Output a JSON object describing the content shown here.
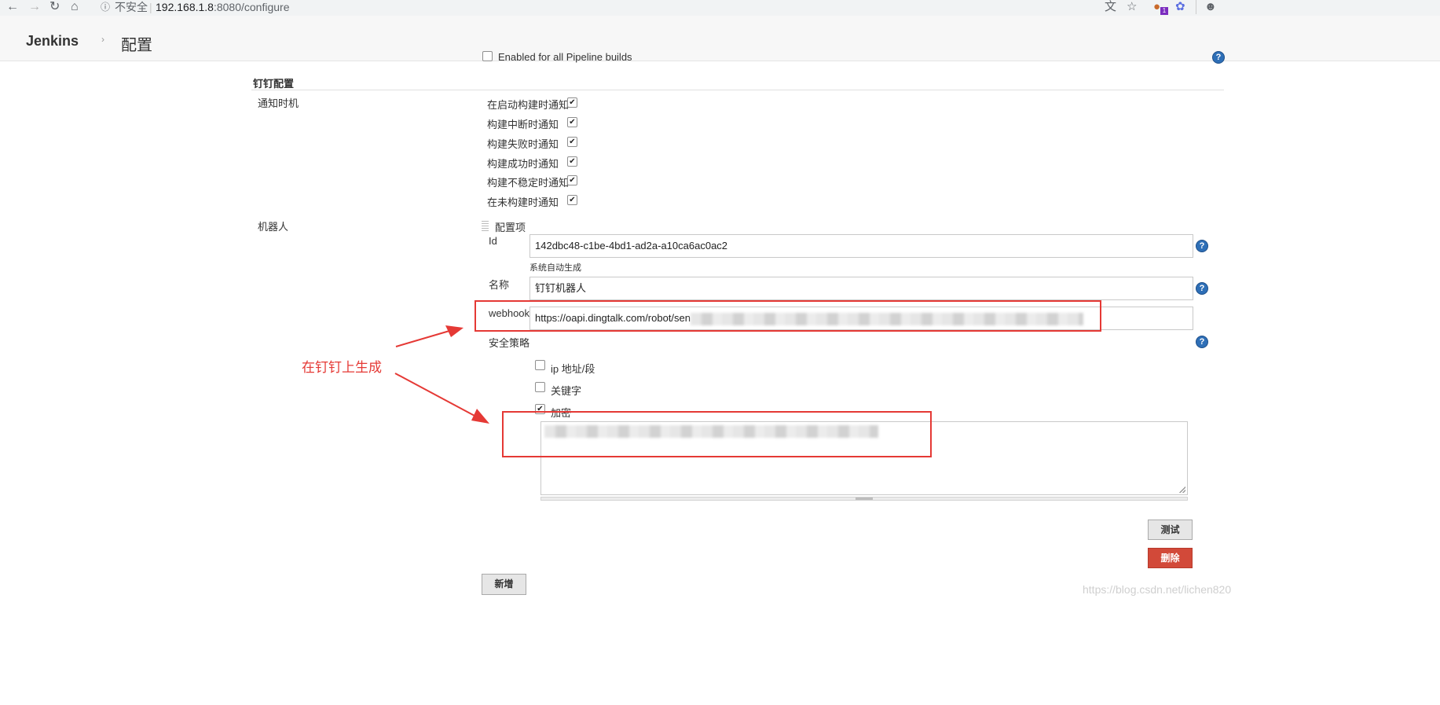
{
  "browser": {
    "security_label": "不安全",
    "url_host": "192.168.1.8",
    "url_rest": ":8080/configure",
    "extension_badge": "1"
  },
  "header": {
    "logo": "Jenkins",
    "breadcrumb_sep": "›",
    "breadcrumb": "配置"
  },
  "pipeline": {
    "enabled_label": "Enabled for all Pipeline builds"
  },
  "dingtalk": {
    "section_title": "钉钉配置",
    "notify_timing_label": "通知时机",
    "notify_options": [
      {
        "label": "在启动构建时通知",
        "checked": true
      },
      {
        "label": "构建中断时通知",
        "checked": true
      },
      {
        "label": "构建失败时通知",
        "checked": true
      },
      {
        "label": "构建成功时通知",
        "checked": true
      },
      {
        "label": "构建不稳定时通知",
        "checked": true
      },
      {
        "label": "在未构建时通知",
        "checked": true
      }
    ],
    "robot_label": "机器人",
    "config_item_label": "配置项",
    "id_label": "Id",
    "id_value": "142dbc48-c1be-4bd1-ad2a-a10ca6ac0ac2",
    "id_hint": "系统自动生成",
    "name_label": "名称",
    "name_value": "钉钉机器人",
    "webhook_label": "webhook",
    "webhook_value": "https://oapi.dingtalk.com/robot/sen",
    "security_label": "安全策略",
    "security_options": [
      {
        "label": "ip 地址/段",
        "checked": false
      },
      {
        "label": "关键字",
        "checked": false
      },
      {
        "label": "加密",
        "checked": true
      }
    ],
    "test_button": "测试",
    "delete_button": "删除",
    "add_button": "新增"
  },
  "annotation": {
    "text": "在钉钉上生成",
    "color": "#e53935"
  },
  "watermark": "https://blog.csdn.net/lichen820"
}
